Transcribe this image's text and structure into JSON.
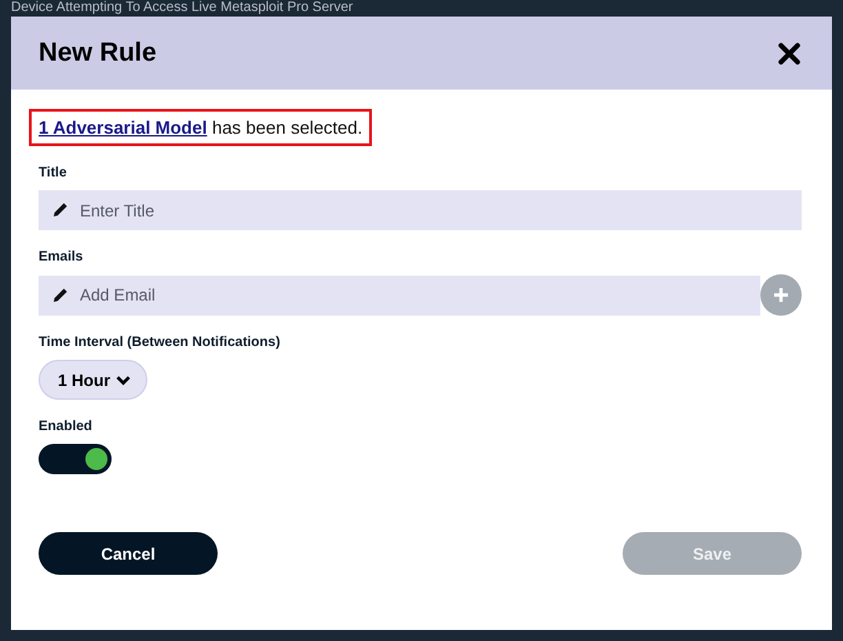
{
  "background": {
    "heading": "Device Attempting To Access Live Metasploit Pro Server"
  },
  "modal": {
    "title": "New Rule",
    "selection": {
      "link": "1 Adversarial Model",
      "text": "has been selected."
    },
    "fields": [
      {
        "kind": "text",
        "label": "Title",
        "placeholder": "Enter Title"
      },
      {
        "kind": "email",
        "label": "Emails",
        "placeholder": "Add Email"
      }
    ],
    "interval": {
      "label": "Time Interval (Between Notifications)",
      "value": "1 Hour"
    },
    "enabled": {
      "label": "Enabled",
      "on": true
    },
    "buttons": [
      {
        "label": "Cancel",
        "disabled": false
      },
      {
        "label": "Save",
        "disabled": true
      }
    ]
  }
}
